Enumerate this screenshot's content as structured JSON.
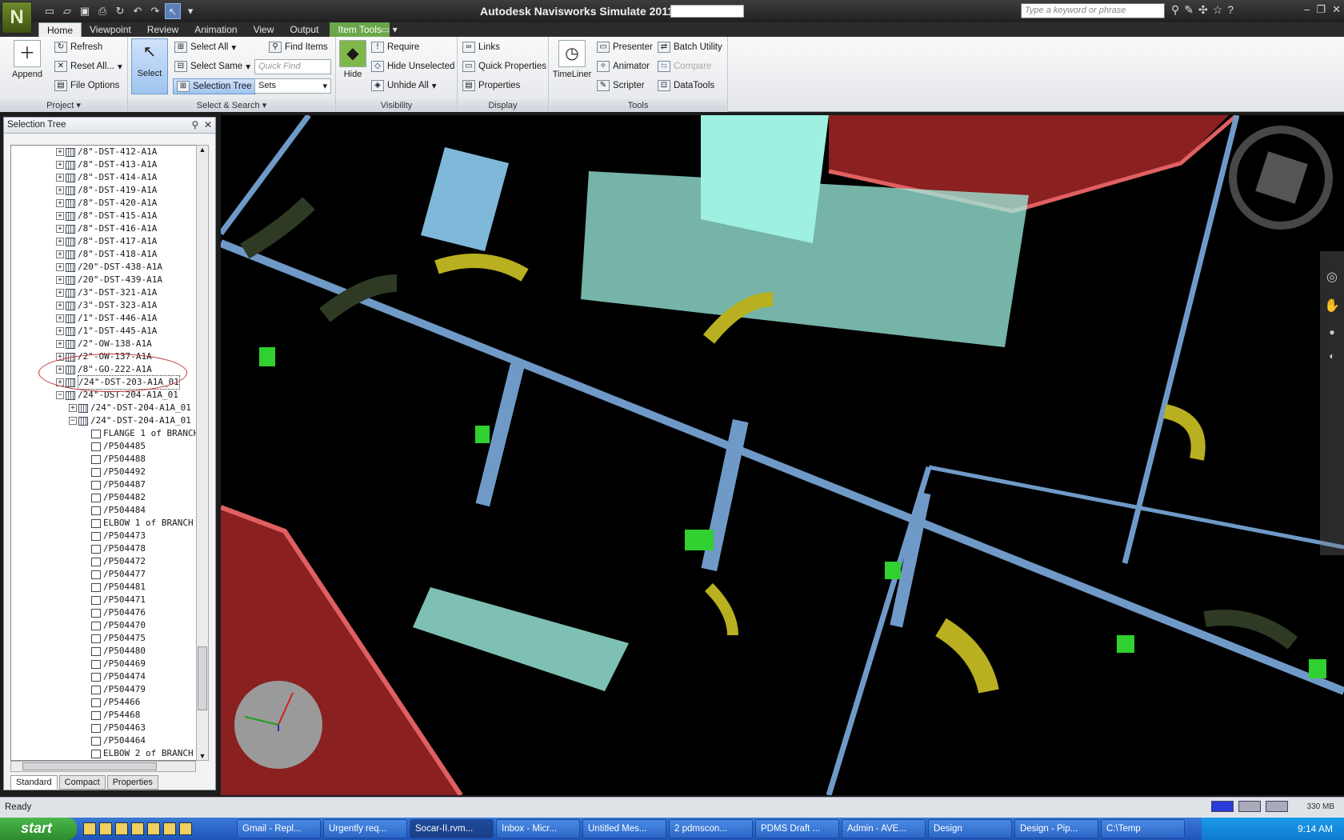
{
  "window": {
    "title": "Autodesk Navisworks Simulate 2011",
    "search_placeholder": "Type a keyword or phrase"
  },
  "tabs": [
    {
      "label": "Home"
    },
    {
      "label": "Viewpoint"
    },
    {
      "label": "Review"
    },
    {
      "label": "Animation"
    },
    {
      "label": "View"
    },
    {
      "label": "Output"
    },
    {
      "label": "Item Tools"
    }
  ],
  "ribbon": {
    "project": {
      "label": "Project",
      "append": "Append",
      "refresh": "Refresh",
      "reset_all": "Reset All...",
      "file_options": "File Options"
    },
    "select_search": {
      "label": "Select & Search",
      "select": "Select",
      "select_all": "Select All",
      "select_same": "Select Same",
      "selection_tree": "Selection Tree",
      "find_items": "Find Items",
      "quick_find_placeholder": "Quick Find",
      "sets": "Sets"
    },
    "visibility": {
      "label": "Visibility",
      "hide": "Hide",
      "require": "Require",
      "hide_unselected": "Hide Unselected",
      "unhide_all": "Unhide All"
    },
    "display": {
      "label": "Display",
      "links": "Links",
      "quick_properties": "Quick Properties",
      "properties": "Properties"
    },
    "tools": {
      "label": "Tools",
      "timeliner": "TimeLiner",
      "presenter": "Presenter",
      "animator": "Animator",
      "scripter": "Scripter",
      "batch_utility": "Batch Utility",
      "compare": "Compare",
      "datatools": "DataTools"
    }
  },
  "selection_tree": {
    "title": "Selection Tree",
    "items": [
      {
        "label": "/8\"-DST-412-A1A"
      },
      {
        "label": "/8\"-DST-413-A1A"
      },
      {
        "label": "/8\"-DST-414-A1A"
      },
      {
        "label": "/8\"-DST-419-A1A"
      },
      {
        "label": "/8\"-DST-420-A1A"
      },
      {
        "label": "/8\"-DST-415-A1A"
      },
      {
        "label": "/8\"-DST-416-A1A"
      },
      {
        "label": "/8\"-DST-417-A1A"
      },
      {
        "label": "/8\"-DST-418-A1A"
      },
      {
        "label": "/20\"-DST-438-A1A"
      },
      {
        "label": "/20\"-DST-439-A1A"
      },
      {
        "label": "/3\"-DST-321-A1A"
      },
      {
        "label": "/3\"-DST-323-A1A"
      },
      {
        "label": "/1\"-DST-446-A1A"
      },
      {
        "label": "/1\"-DST-445-A1A"
      },
      {
        "label": "/2\"-OW-138-A1A"
      },
      {
        "label": "/2\"-OW-137-A1A"
      },
      {
        "label": "/8\"-GO-222-A1A"
      },
      {
        "label": "/24\"-DST-203-A1A_01"
      },
      {
        "label": "/24\"-DST-204-A1A_01"
      },
      {
        "label": "/24\"-DST-204-A1A_01"
      },
      {
        "label": "/24\"-DST-204-A1A_01"
      },
      {
        "label": "FLANGE 1 of BRANCH"
      },
      {
        "label": "/P504485"
      },
      {
        "label": "/P504488"
      },
      {
        "label": "/P504492"
      },
      {
        "label": "/P504487"
      },
      {
        "label": "/P504482"
      },
      {
        "label": "/P504484"
      },
      {
        "label": "ELBOW 1 of BRANCH"
      },
      {
        "label": "/P504473"
      },
      {
        "label": "/P504478"
      },
      {
        "label": "/P504472"
      },
      {
        "label": "/P504477"
      },
      {
        "label": "/P504481"
      },
      {
        "label": "/P504471"
      },
      {
        "label": "/P504476"
      },
      {
        "label": "/P504470"
      },
      {
        "label": "/P504475"
      },
      {
        "label": "/P504480"
      },
      {
        "label": "/P504469"
      },
      {
        "label": "/P504474"
      },
      {
        "label": "/P504479"
      },
      {
        "label": "/P54466"
      },
      {
        "label": "/P54468"
      },
      {
        "label": "/P504463"
      },
      {
        "label": "/P504464"
      },
      {
        "label": "ELBOW 2 of BRANCH"
      }
    ],
    "tabs": [
      "Standard",
      "Compact",
      "Properties"
    ]
  },
  "status": {
    "text": "Ready",
    "memory": "330 MB"
  },
  "taskbar": {
    "start": "start",
    "tasks": [
      "Gmail - Repl...",
      "Urgently req...",
      "Socar-II.rvm...",
      "Inbox - Micr...",
      "Untitled Mes...",
      "2 pdmscon...",
      "PDMS Draft ...",
      "Admin - AVE...",
      "Design",
      "Design - Pip...",
      "C:\\Temp"
    ],
    "clock": "9:14 AM"
  },
  "colors": {
    "viewport": "#000000",
    "structure": "#6f9ac8",
    "pipe": "#b8b020",
    "platform": "#9ef0e0",
    "tank": "#8a2020",
    "accent_green": "#30d030"
  }
}
